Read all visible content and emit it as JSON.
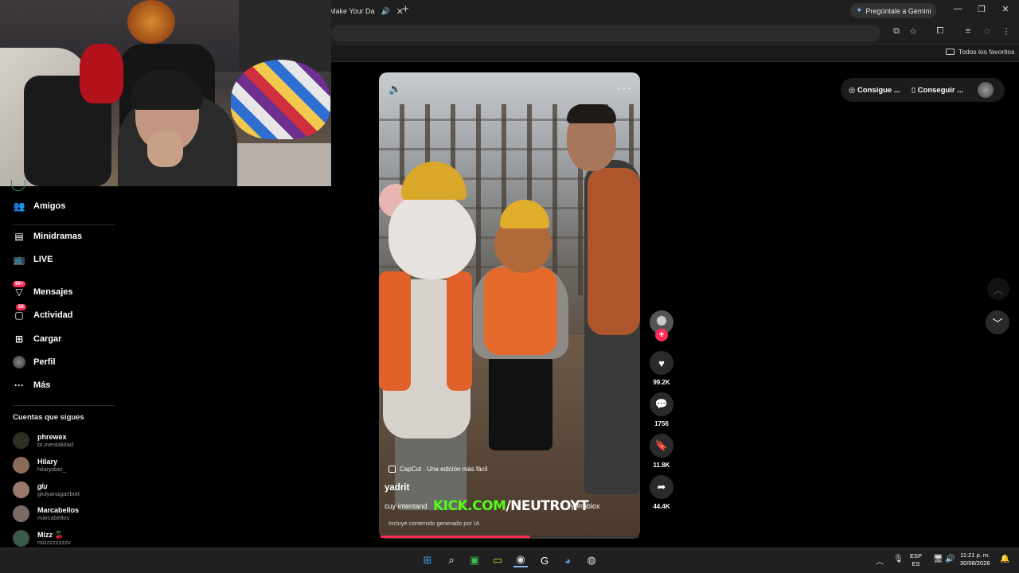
{
  "browser": {
    "tab_title": "Make Your Da",
    "gemini_label": "Pregúntale a Gemini",
    "favorites_label": "Todos los favoritos"
  },
  "sidebar": {
    "items": [
      {
        "label": "Amigos",
        "icon": "friends-icon"
      },
      {
        "label": "Minidramas",
        "icon": "minidramas-icon"
      },
      {
        "label": "LIVE",
        "icon": "live-tv-icon"
      },
      {
        "label": "Mensajes",
        "icon": "messages-icon",
        "badge": "99+"
      },
      {
        "label": "Actividad",
        "icon": "activity-icon",
        "badge": "58"
      },
      {
        "label": "Cargar",
        "icon": "upload-icon"
      },
      {
        "label": "Perfil",
        "icon": "profile-icon"
      },
      {
        "label": "Más",
        "icon": "more-icon"
      }
    ],
    "following_title": "Cuentas que sigues",
    "following": [
      {
        "name": "phrewex",
        "handle": "bt.mentalidad"
      },
      {
        "name": "Hilary",
        "handle": "hilarydiaz_"
      },
      {
        "name": "𝑔𝑖𝑢",
        "handle": "giulyanagaribott"
      },
      {
        "name": "Marcabellos",
        "handle": "marcabellos"
      },
      {
        "name": "Mizz 🍒",
        "handle": "mizzzzzzzzv"
      }
    ]
  },
  "video": {
    "capcut_label": "CapCut · Una edición más fácil",
    "author": "yadrit",
    "description_start": "cuy intentand",
    "description_tag": "y #roblox",
    "ai_notice": "Incluye contenido generado por IA",
    "progress": 0.58
  },
  "overlay": {
    "kick_green": "KICK.COM",
    "kick_white": "/NEUTROYT"
  },
  "actions": {
    "likes": "99.2K",
    "comments": "1756",
    "saves": "11.8K",
    "shares": "44.4K"
  },
  "top_buttons": {
    "coins": "Consigue ...",
    "app": "Conseguir ..."
  },
  "taskbar": {
    "lang_top": "ESP",
    "lang_bottom": "ES",
    "time": "11:21 p. m.",
    "date": "30/08/2026"
  },
  "colors": {
    "accent": "#fe2c55",
    "kick_green": "#53fc18"
  }
}
